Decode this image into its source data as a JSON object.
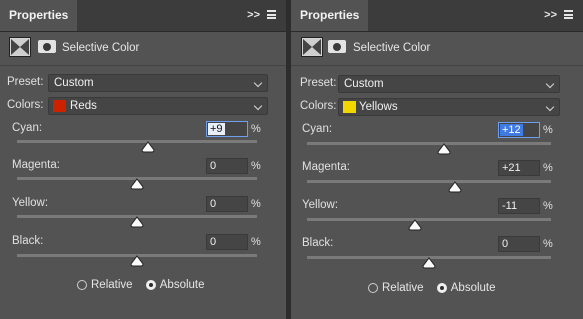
{
  "panels": [
    {
      "tab_title": "Properties",
      "tab_menu_label": ">>",
      "adjustment_title": "Selective Color",
      "preset_label": "Preset:",
      "preset_value": "Custom",
      "colors_label": "Colors:",
      "colors_value": "Reds",
      "colors_swatch": "#cc2200",
      "sliders": [
        {
          "label": "Cyan:",
          "value": "+9",
          "unit": "%",
          "percent": 9,
          "selected": true
        },
        {
          "label": "Magenta:",
          "value": "0",
          "unit": "%",
          "percent": 0
        },
        {
          "label": "Yellow:",
          "value": "0",
          "unit": "%",
          "percent": 0
        },
        {
          "label": "Black:",
          "value": "0",
          "unit": "%",
          "percent": 0
        }
      ],
      "method_relative": "Relative",
      "method_absolute": "Absolute",
      "method_selected": "Absolute"
    },
    {
      "tab_title": "Properties",
      "tab_menu_label": ">>",
      "adjustment_title": "Selective Color",
      "preset_label": "Preset:",
      "preset_value": "Custom",
      "colors_label": "Colors:",
      "colors_value": "Yellows",
      "colors_swatch": "#f2d600",
      "sliders": [
        {
          "label": "Cyan:",
          "value": "+12",
          "unit": "%",
          "percent": 12,
          "selected": true
        },
        {
          "label": "Magenta:",
          "value": "+21",
          "unit": "%",
          "percent": 21
        },
        {
          "label": "Yellow:",
          "value": "-11",
          "unit": "%",
          "percent": -11
        },
        {
          "label": "Black:",
          "value": "0",
          "unit": "%",
          "percent": 0
        }
      ],
      "method_relative": "Relative",
      "method_absolute": "Absolute",
      "method_selected": "Absolute"
    }
  ],
  "colors": {
    "accent": "#3f7be0",
    "panel": "#535353"
  }
}
